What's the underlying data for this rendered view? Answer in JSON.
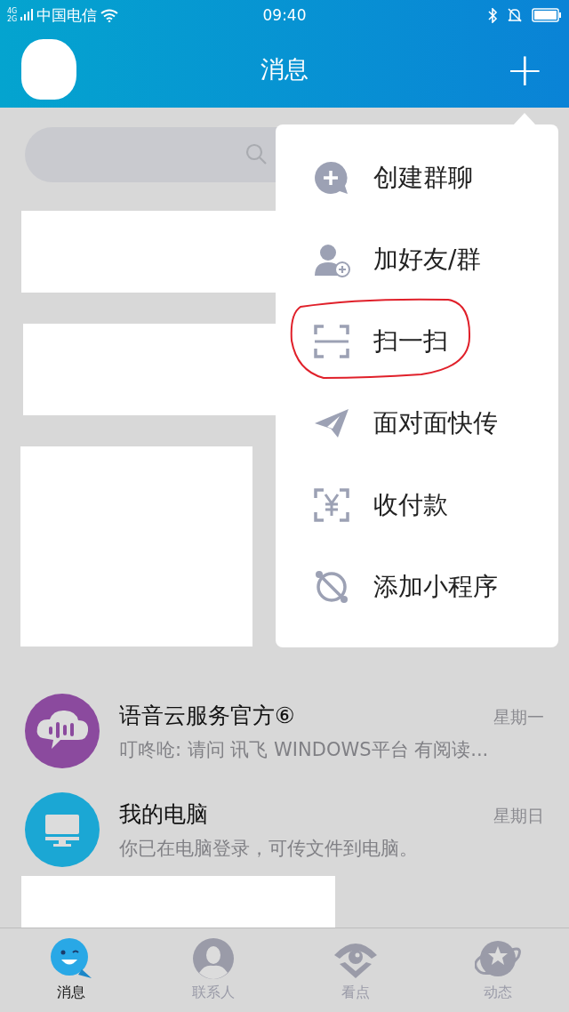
{
  "status_bar": {
    "network_top": "4G",
    "network_bottom": "2G",
    "carrier": "中国电信",
    "time": "09:40"
  },
  "header": {
    "title": "消息",
    "add_button": "+"
  },
  "menu": {
    "items": [
      {
        "label": "创建群聊",
        "circled": false
      },
      {
        "label": "加好友/群",
        "circled": false
      },
      {
        "label": "扫一扫",
        "circled": true
      },
      {
        "label": "面对面快传",
        "circled": false
      },
      {
        "label": "收付款",
        "circled": false
      },
      {
        "label": "添加小程序",
        "circled": false
      }
    ]
  },
  "chats": [
    {
      "name": "语音云服务官方⑥",
      "time": "星期一",
      "preview": "叮咚呛: 请问 讯飞 WINDOWS平台 有阅读..."
    },
    {
      "name": "我的电脑",
      "time": "星期日",
      "preview": "你已在电脑登录，可传文件到电脑。"
    }
  ],
  "tabs": [
    {
      "label": "消息",
      "selected": true
    },
    {
      "label": "联系人",
      "selected": false
    },
    {
      "label": "看点",
      "selected": false
    },
    {
      "label": "动态",
      "selected": false
    }
  ]
}
